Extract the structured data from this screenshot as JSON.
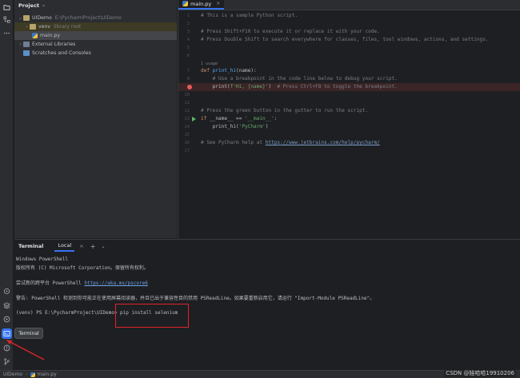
{
  "project_panel": {
    "title": "Project",
    "tree": [
      {
        "label": "UIDemo",
        "hint": "E:\\PycharmProject\\UIDemo",
        "icon": "folder-icon",
        "expanded": true
      },
      {
        "label": "venv",
        "hint": "library root",
        "icon": "folder-icon",
        "expanded": false
      },
      {
        "label": "main.py",
        "hint": "",
        "icon": "python-file-icon"
      },
      {
        "label": "External Libraries",
        "hint": "",
        "icon": "library-icon",
        "expanded": false
      },
      {
        "label": "Scratches and Consoles",
        "hint": "",
        "icon": "scratches-icon"
      }
    ]
  },
  "editor": {
    "tab_label": "main.py",
    "line_numbers": [
      "1",
      "2",
      "3",
      "4",
      "5",
      "6",
      "7",
      "8",
      "9",
      "10",
      "11",
      "12",
      "13",
      "14",
      "15",
      "16",
      "17"
    ],
    "usage_hint": "1 usage",
    "lines": {
      "l1": "# This is a sample Python script.",
      "l3": "# Press Shift+F10 to execute it or replace it with your code.",
      "l4": "# Press Double Shift to search everywhere for classes, files, tool windows, actions, and settings.",
      "l7_kw": "def ",
      "l7_fn": "print_hi",
      "l7_rest": "(name):",
      "l8": "    # Use a breakpoint in the code line below to debug your script.",
      "l9_a": "    print(",
      "l9_b": "f'Hi, {name}'",
      "l9_c": ")  ",
      "l9_d": "# Press Ctrl+F8 to toggle the breakpoint.",
      "l12": "# Press the green button in the gutter to run the script.",
      "l13_kw": "if ",
      "l13_b": "__name__ == ",
      "l13_c": "'__main__'",
      "l13_d": ":",
      "l14_a": "    print_hi(",
      "l14_b": "'PyCharm'",
      "l14_c": ")",
      "l16_a": "# See PyCharm help at ",
      "l16_b": "https://www.jetbrains.com/help/pycharm/"
    }
  },
  "terminal": {
    "title": "Terminal",
    "tab_label": "Local",
    "close_glyph": "×",
    "add_glyph": "+",
    "more_glyph": "⌄",
    "lines": {
      "t1": "Windows PowerShell",
      "t2": "版权所有 (C) Microsoft Corporation。保留所有权利。",
      "t3_a": "尝试新的跨平台 PowerShell ",
      "t3_b": "https://aka.ms/pscore6",
      "t4": "警告: PowerShell 检测到你可能正在使用屏幕阅读器，并且已出于兼容性目的禁用 PSReadLine。如果要重新启用它，请运行 \"Import-Module PSReadLine\"。",
      "t5": "(venv) PS E:\\PycharmProject\\UIDemo> pip install selenium"
    }
  },
  "tooltip": "Terminal",
  "statusbar": {
    "project": "UIDemo",
    "separator": "›",
    "file": "main.py"
  },
  "watermark": "CSDN @娃哈哈19910206",
  "colors": {
    "accent": "#3574f0",
    "annotation_red": "#e0242a",
    "breakpoint": "#e55b5b",
    "run_green": "#5fb865"
  }
}
